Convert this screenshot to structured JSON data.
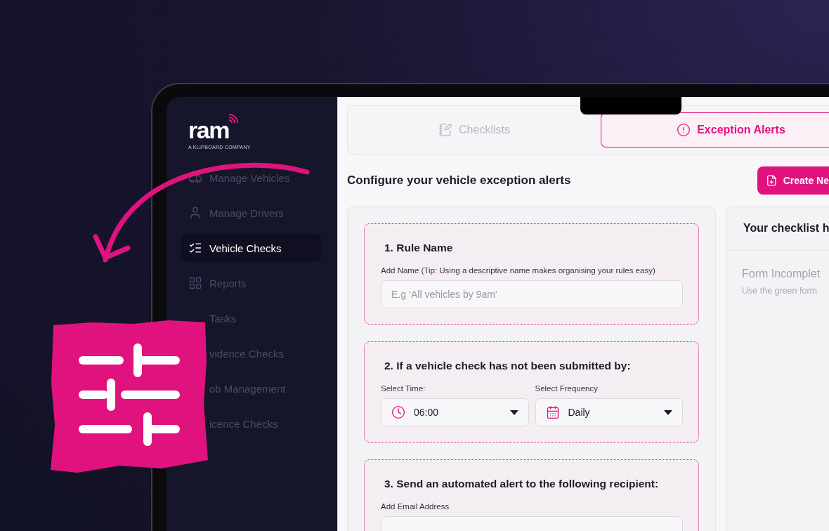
{
  "logo": {
    "name": "ram",
    "tagline": "A KLIPBOARD COMPANY"
  },
  "sidebar": {
    "items": [
      {
        "label": "Manage Vehicles",
        "selected": false
      },
      {
        "label": "Manage Drivers",
        "selected": false
      },
      {
        "label": "Vehicle Checks",
        "selected": true
      },
      {
        "label": "Reports",
        "selected": false
      },
      {
        "label": "Tasks",
        "selected": false
      },
      {
        "label": "vidence Checks",
        "selected": false
      },
      {
        "label": "ob Management",
        "selected": false
      },
      {
        "label": "icence Checks",
        "selected": false
      }
    ]
  },
  "tabs": [
    {
      "label": "Checklists",
      "selected": false
    },
    {
      "label": "Exception Alerts",
      "selected": true
    }
  ],
  "heading": "Configure your vehicle exception alerts",
  "create_button": "Create Ne",
  "sections": [
    {
      "title": "1. Rule Name",
      "fields": [
        {
          "kind": "text",
          "label": "Add Name (Tip: Using a descriptive name makes organising your rules easy)",
          "placeholder": "E.g ‘All vehicles by 9am’"
        }
      ]
    },
    {
      "title": "2. If a vehicle check has not been submitted by:",
      "fields": [
        {
          "kind": "select",
          "label": "Select Time:",
          "value": "06:00"
        },
        {
          "kind": "select",
          "label": "Select Frequency",
          "value": "Daily"
        }
      ]
    },
    {
      "title": "3. Send an automated alert to the following recipient:",
      "fields": [
        {
          "kind": "text",
          "label": "Add Email Address"
        }
      ]
    }
  ],
  "side_panel": {
    "title": "Your checklist h",
    "status": "Form Incomplet",
    "hint": "Use the green form"
  }
}
